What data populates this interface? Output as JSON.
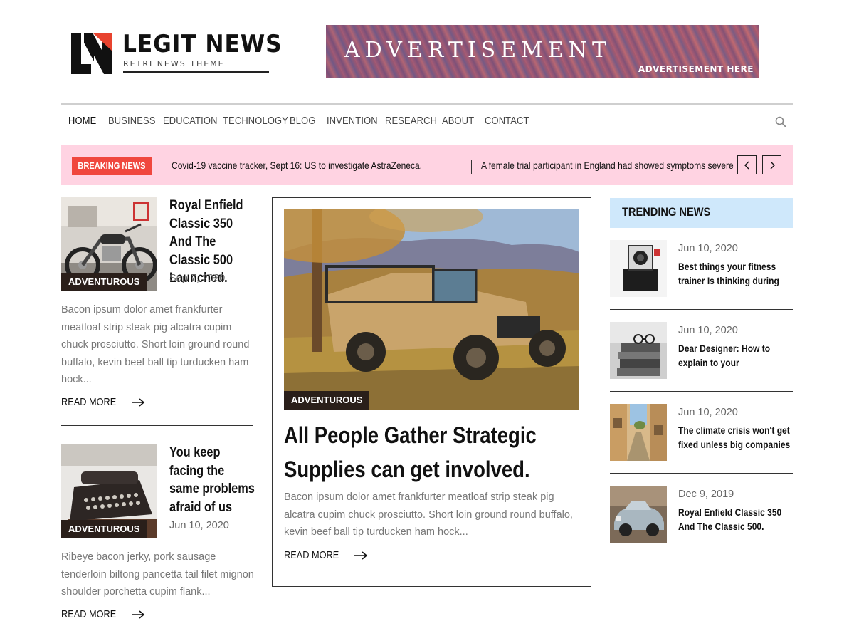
{
  "header": {
    "logo_title": "LEGIT NEWS",
    "logo_subtitle": "RETRI NEWS THEME",
    "ad_title": "ADVERTISEMENT",
    "ad_subtitle": "ADVERTISEMENT HERE"
  },
  "nav": {
    "items": [
      {
        "label": "HOME",
        "active": true
      },
      {
        "label": "BUSINESS"
      },
      {
        "label": "EDUCATION"
      },
      {
        "label": "TECHNOLOGY"
      },
      {
        "label": "BLOG"
      },
      {
        "label": "INVENTION"
      },
      {
        "label": "RESEARCH"
      },
      {
        "label": "ABOUT"
      },
      {
        "label": "CONTACT"
      }
    ],
    "search_icon": "search-icon"
  },
  "breaking": {
    "badge": "BREAKING NEWS",
    "items": [
      "Covid-19 vaccine tracker, Sept 16: US to investigate AstraZeneca.",
      "A female trial participant in England had showed symptoms severe"
    ]
  },
  "left_posts": [
    {
      "category": "ADVENTUROUS",
      "title": "Royal Enfield Classic 350 And The Classic 500 Launched.",
      "date": "Sep 7, 2020",
      "excerpt": "Bacon ipsum dolor amet frankfurter meatloaf strip steak pig alcatra cupim chuck prosciutto. Short loin ground round buffalo, kevin beef ball tip turducken ham hock...",
      "read_more": "READ MORE"
    },
    {
      "category": "ADVENTUROUS",
      "title": "You keep facing the same problems afraid of us",
      "date": "Jun 10, 2020",
      "excerpt": "Ribeye bacon jerky, pork sausage tenderloin biltong pancetta tail filet mignon shoulder porchetta cupim flank...",
      "read_more": "READ MORE"
    }
  ],
  "feature": {
    "category": "ADVENTUROUS",
    "title": "All People Gather Strategic Supplies can get involved.",
    "excerpt": "Bacon ipsum dolor amet frankfurter meatloaf strip steak pig alcatra cupim chuck prosciutto. Short loin ground round buffalo, kevin beef ball tip turducken ham hock...",
    "read_more": "READ MORE"
  },
  "trending": {
    "heading": "TRENDING NEWS",
    "items": [
      {
        "date": "Jun 10, 2020",
        "title": "Best things your fitness trainer Is thinking during"
      },
      {
        "date": "Jun 10, 2020",
        "title": "Dear Designer: How to explain to your"
      },
      {
        "date": "Jun 10, 2020",
        "title": "The climate crisis won't get fixed unless big companies"
      },
      {
        "date": "Dec 9, 2019",
        "title": "Royal Enfield Classic 350 And The Classic 500."
      }
    ]
  },
  "colors": {
    "breaking_bg": "#ffd3e2",
    "breaking_badge": "#f0473e",
    "trending_bg": "#cfe8fb",
    "category_badge": "#2a1f1a"
  }
}
